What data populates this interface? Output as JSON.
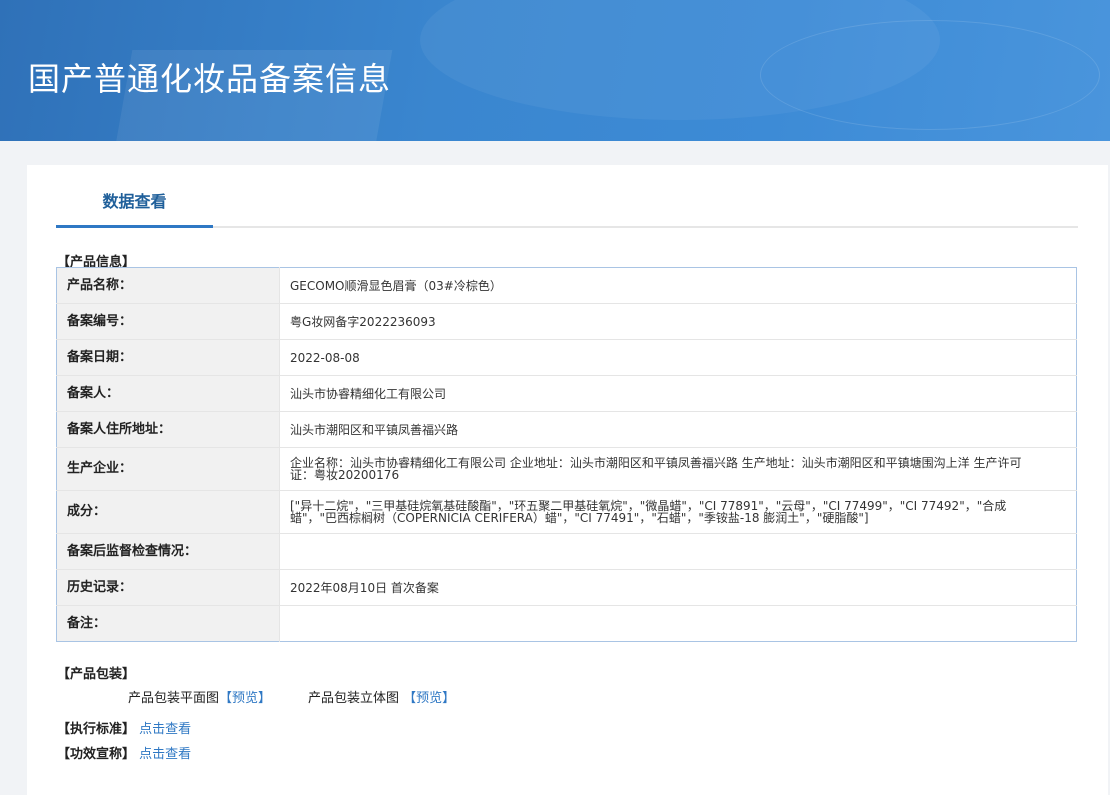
{
  "header": {
    "title": "国产普通化妆品备案信息"
  },
  "tabs": [
    {
      "label": "数据查看",
      "active": true
    }
  ],
  "product_info": {
    "section_label": "【产品信息】",
    "rows": [
      {
        "key": "产品名称：",
        "value": "GECOMO顺滑显色眉膏（03#冷棕色）"
      },
      {
        "key": "备案编号：",
        "value": "粤G妆网备字2022236093"
      },
      {
        "key": "备案日期：",
        "value": "2022-08-08"
      },
      {
        "key": "备案人：",
        "value": "汕头市协睿精细化工有限公司"
      },
      {
        "key": "备案人住所地址：",
        "value": "汕头市潮阳区和平镇凤善福兴路"
      },
      {
        "key": "生产企业：",
        "value": "企业名称：汕头市协睿精细化工有限公司 企业地址：汕头市潮阳区和平镇凤善福兴路 生产地址：汕头市潮阳区和平镇塘围沟上洋 生产许可证：粤妆20200176"
      },
      {
        "key": "成分：",
        "value": "[\"异十二烷\"，\"三甲基硅烷氧基硅酸酯\"，\"环五聚二甲基硅氧烷\"，\"微晶蜡\"，\"CI 77891\"，\"云母\"，\"CI 77499\"，\"CI 77492\"，\"合成蜡\"，\"巴西棕榈树（COPERNICIA CERIFERA）蜡\"，\"CI 77491\"，\"石蜡\"，\"季铵盐-18 膨润土\"，\"硬脂酸\"]"
      },
      {
        "key": "备案后监督检查情况：",
        "value": ""
      },
      {
        "key": "历史记录：",
        "value": "2022年08月10日 首次备案"
      },
      {
        "key": "备注：",
        "value": ""
      }
    ]
  },
  "packaging": {
    "section_label": "【产品包装】",
    "flat_label": "产品包装平面图",
    "flat_link": "【预览】",
    "solid_label": "产品包装立体图",
    "solid_link": "【预览】"
  },
  "standard": {
    "label": "【执行标准】",
    "link": "点击查看"
  },
  "efficacy": {
    "label": "【功效宣称】",
    "link": "点击查看"
  },
  "colors": {
    "banner": "#3a86cf",
    "accent": "#2f78c4",
    "link": "#2f78c4"
  }
}
